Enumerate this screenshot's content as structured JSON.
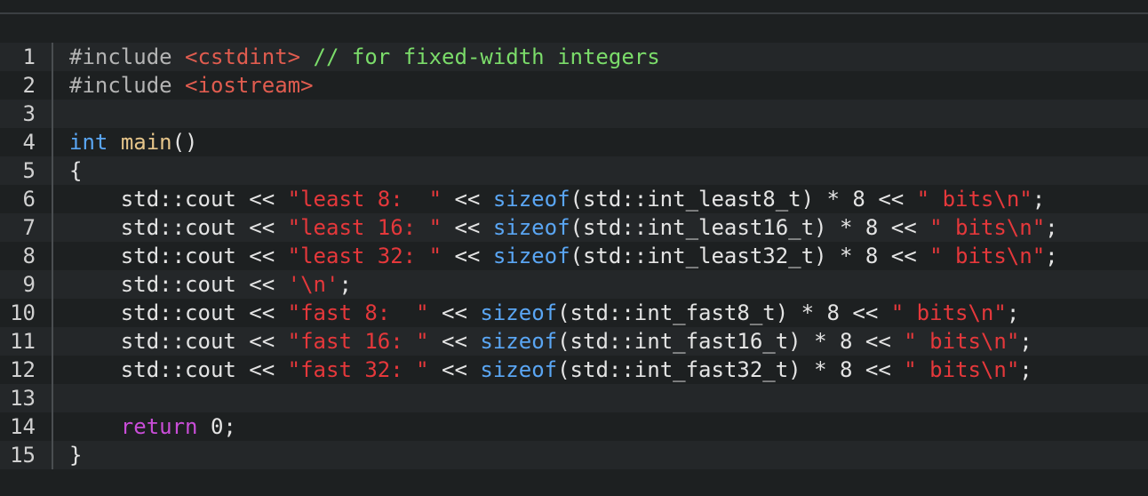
{
  "colors": {
    "background": "#1d2021",
    "preprocessor": "#b4b4b4",
    "header": "#e05c4f",
    "comment": "#7bdc6a",
    "type": "#5aa6f4",
    "string": "#e5383b",
    "keyword": "#c94dd8"
  },
  "code": {
    "lines": [
      {
        "number": "1",
        "tokens": [
          {
            "t": "#include ",
            "k": "pre"
          },
          {
            "t": "<cstdint>",
            "k": "header"
          },
          {
            "t": " ",
            "k": "plain"
          },
          {
            "t": "// for fixed-width integers",
            "k": "comment"
          }
        ]
      },
      {
        "number": "2",
        "tokens": [
          {
            "t": "#include ",
            "k": "pre"
          },
          {
            "t": "<iostream>",
            "k": "header"
          }
        ]
      },
      {
        "number": "3",
        "tokens": []
      },
      {
        "number": "4",
        "tokens": [
          {
            "t": "int",
            "k": "type"
          },
          {
            "t": " ",
            "k": "plain"
          },
          {
            "t": "main",
            "k": "func"
          },
          {
            "t": "()",
            "k": "plain"
          }
        ]
      },
      {
        "number": "5",
        "tokens": [
          {
            "t": "{",
            "k": "plain"
          }
        ]
      },
      {
        "number": "6",
        "tokens": [
          {
            "t": "    std::cout << ",
            "k": "plain"
          },
          {
            "t": "\"least 8:  \"",
            "k": "string"
          },
          {
            "t": " << ",
            "k": "plain"
          },
          {
            "t": "sizeof",
            "k": "builtin"
          },
          {
            "t": "(std::int_least8_t) * 8 << ",
            "k": "plain"
          },
          {
            "t": "\" bits\\n\"",
            "k": "string"
          },
          {
            "t": ";",
            "k": "plain"
          }
        ]
      },
      {
        "number": "7",
        "tokens": [
          {
            "t": "    std::cout << ",
            "k": "plain"
          },
          {
            "t": "\"least 16: \"",
            "k": "string"
          },
          {
            "t": " << ",
            "k": "plain"
          },
          {
            "t": "sizeof",
            "k": "builtin"
          },
          {
            "t": "(std::int_least16_t) * 8 << ",
            "k": "plain"
          },
          {
            "t": "\" bits\\n\"",
            "k": "string"
          },
          {
            "t": ";",
            "k": "plain"
          }
        ]
      },
      {
        "number": "8",
        "tokens": [
          {
            "t": "    std::cout << ",
            "k": "plain"
          },
          {
            "t": "\"least 32: \"",
            "k": "string"
          },
          {
            "t": " << ",
            "k": "plain"
          },
          {
            "t": "sizeof",
            "k": "builtin"
          },
          {
            "t": "(std::int_least32_t) * 8 << ",
            "k": "plain"
          },
          {
            "t": "\" bits\\n\"",
            "k": "string"
          },
          {
            "t": ";",
            "k": "plain"
          }
        ]
      },
      {
        "number": "9",
        "tokens": [
          {
            "t": "    std::cout << ",
            "k": "plain"
          },
          {
            "t": "'\\n'",
            "k": "string"
          },
          {
            "t": ";",
            "k": "plain"
          }
        ]
      },
      {
        "number": "10",
        "tokens": [
          {
            "t": "    std::cout << ",
            "k": "plain"
          },
          {
            "t": "\"fast 8:  \"",
            "k": "string"
          },
          {
            "t": " << ",
            "k": "plain"
          },
          {
            "t": "sizeof",
            "k": "builtin"
          },
          {
            "t": "(std::int_fast8_t) * 8 << ",
            "k": "plain"
          },
          {
            "t": "\" bits\\n\"",
            "k": "string"
          },
          {
            "t": ";",
            "k": "plain"
          }
        ]
      },
      {
        "number": "11",
        "tokens": [
          {
            "t": "    std::cout << ",
            "k": "plain"
          },
          {
            "t": "\"fast 16: \"",
            "k": "string"
          },
          {
            "t": " << ",
            "k": "plain"
          },
          {
            "t": "sizeof",
            "k": "builtin"
          },
          {
            "t": "(std::int_fast16_t) * 8 << ",
            "k": "plain"
          },
          {
            "t": "\" bits\\n\"",
            "k": "string"
          },
          {
            "t": ";",
            "k": "plain"
          }
        ]
      },
      {
        "number": "12",
        "tokens": [
          {
            "t": "    std::cout << ",
            "k": "plain"
          },
          {
            "t": "\"fast 32: \"",
            "k": "string"
          },
          {
            "t": " << ",
            "k": "plain"
          },
          {
            "t": "sizeof",
            "k": "builtin"
          },
          {
            "t": "(std::int_fast32_t) * 8 << ",
            "k": "plain"
          },
          {
            "t": "\" bits\\n\"",
            "k": "string"
          },
          {
            "t": ";",
            "k": "plain"
          }
        ]
      },
      {
        "number": "13",
        "tokens": []
      },
      {
        "number": "14",
        "tokens": [
          {
            "t": "    ",
            "k": "plain"
          },
          {
            "t": "return",
            "k": "keyword"
          },
          {
            "t": " 0;",
            "k": "plain"
          }
        ]
      },
      {
        "number": "15",
        "tokens": [
          {
            "t": "}",
            "k": "plain"
          }
        ]
      }
    ]
  }
}
